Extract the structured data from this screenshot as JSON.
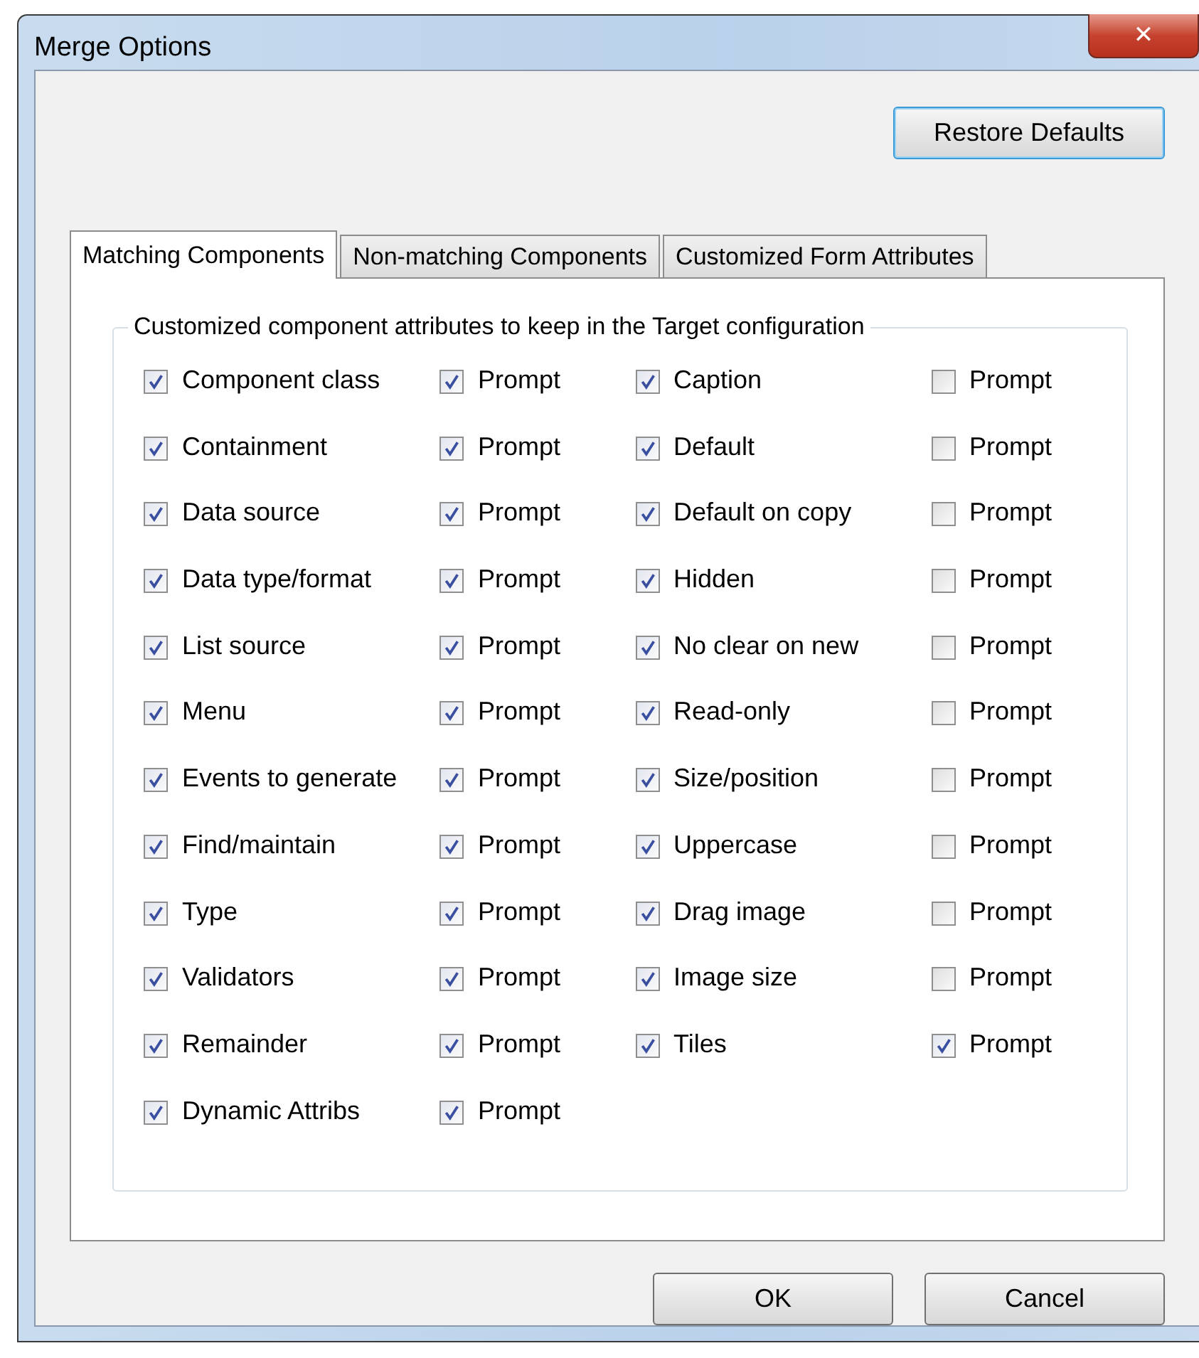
{
  "window": {
    "title": "Merge Options",
    "close": "✕"
  },
  "restore_button": "Restore Defaults",
  "tabs": [
    {
      "label": "Matching Components",
      "selected": true
    },
    {
      "label": "Non-matching Components",
      "selected": false
    },
    {
      "label": "Customized Form Attributes",
      "selected": false
    }
  ],
  "group": {
    "legend": "Customized component attributes to keep in the Target configuration",
    "columns": [
      {
        "items": [
          {
            "label": "Component class",
            "checked": true,
            "prompt": {
              "label": "Prompt",
              "checked": true
            }
          },
          {
            "label": "Containment",
            "checked": true,
            "prompt": {
              "label": "Prompt",
              "checked": true
            }
          },
          {
            "label": "Data source",
            "checked": true,
            "prompt": {
              "label": "Prompt",
              "checked": true
            }
          },
          {
            "label": "Data type/format",
            "checked": true,
            "prompt": {
              "label": "Prompt",
              "checked": true
            }
          },
          {
            "label": "List source",
            "checked": true,
            "prompt": {
              "label": "Prompt",
              "checked": true
            }
          },
          {
            "label": "Menu",
            "checked": true,
            "prompt": {
              "label": "Prompt",
              "checked": true
            }
          },
          {
            "label": "Events to generate",
            "checked": true,
            "prompt": {
              "label": "Prompt",
              "checked": true
            }
          },
          {
            "label": "Find/maintain",
            "checked": true,
            "prompt": {
              "label": "Prompt",
              "checked": true
            }
          },
          {
            "label": "Type",
            "checked": true,
            "prompt": {
              "label": "Prompt",
              "checked": true
            }
          },
          {
            "label": "Validators",
            "checked": true,
            "prompt": {
              "label": "Prompt",
              "checked": true
            }
          },
          {
            "label": "Remainder",
            "checked": true,
            "prompt": {
              "label": "Prompt",
              "checked": true
            }
          },
          {
            "label": "Dynamic Attribs",
            "checked": true,
            "prompt": {
              "label": "Prompt",
              "checked": true
            }
          }
        ]
      },
      {
        "items": [
          {
            "label": "Caption",
            "checked": true,
            "prompt": {
              "label": "Prompt",
              "checked": false
            }
          },
          {
            "label": "Default",
            "checked": true,
            "prompt": {
              "label": "Prompt",
              "checked": false
            }
          },
          {
            "label": "Default on copy",
            "checked": true,
            "prompt": {
              "label": "Prompt",
              "checked": false
            }
          },
          {
            "label": "Hidden",
            "checked": true,
            "prompt": {
              "label": "Prompt",
              "checked": false
            }
          },
          {
            "label": "No clear on new",
            "checked": true,
            "prompt": {
              "label": "Prompt",
              "checked": false
            }
          },
          {
            "label": "Read-only",
            "checked": true,
            "prompt": {
              "label": "Prompt",
              "checked": false
            }
          },
          {
            "label": "Size/position",
            "checked": true,
            "prompt": {
              "label": "Prompt",
              "checked": false
            }
          },
          {
            "label": "Uppercase",
            "checked": true,
            "prompt": {
              "label": "Prompt",
              "checked": false
            }
          },
          {
            "label": "Drag image",
            "checked": true,
            "prompt": {
              "label": "Prompt",
              "checked": false
            }
          },
          {
            "label": "Image size",
            "checked": true,
            "prompt": {
              "label": "Prompt",
              "checked": false
            }
          },
          {
            "label": "Tiles",
            "checked": true,
            "prompt": {
              "label": "Prompt",
              "checked": true
            }
          }
        ]
      }
    ]
  },
  "buttons": [
    "OK",
    "Cancel"
  ]
}
